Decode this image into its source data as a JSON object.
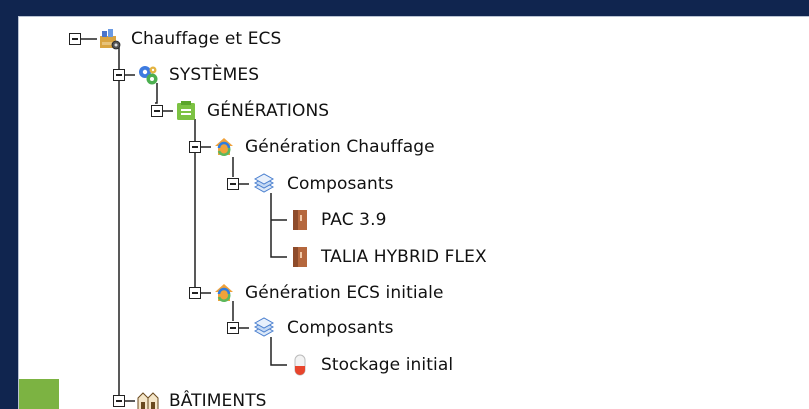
{
  "tree": {
    "root": {
      "label": "Chauffage et ECS",
      "icon": "boiler-house-icon"
    },
    "systemes": {
      "label": "SYSTÈMES",
      "icon": "gears-icon"
    },
    "generations": {
      "label": "GÉNÉRATIONS",
      "icon": "green-folder-icon"
    },
    "gen_chauffage": {
      "label": "Génération Chauffage",
      "icon": "house-recycle-icon"
    },
    "composants_1": {
      "label": "Composants",
      "icon": "layers-icon"
    },
    "pac": {
      "label": "PAC 3.9",
      "icon": "cabinet-unit-icon"
    },
    "talia": {
      "label": "TALIA HYBRID FLEX",
      "icon": "cabinet-unit-icon"
    },
    "gen_ecs": {
      "label": "Génération ECS initiale",
      "icon": "house-recycle-icon"
    },
    "composants_2": {
      "label": "Composants",
      "icon": "layers-icon"
    },
    "stockage": {
      "label": "Stockage initial",
      "icon": "water-tank-icon"
    },
    "batiments": {
      "label": "BÂTIMENTS",
      "icon": "buildings-icon"
    }
  },
  "colors": {
    "window_frame": "#10254f",
    "panel_bg": "#ffffff",
    "tree_line": "#222222",
    "green_strip": "#7cb342"
  }
}
